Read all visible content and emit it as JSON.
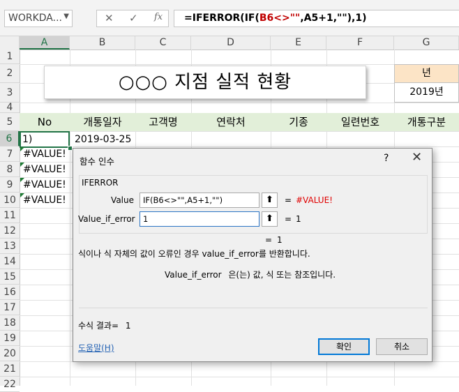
{
  "formula_bar": {
    "name_box": "WORKDA...",
    "cancel_icon": "✕",
    "enter_icon": "✓",
    "fx_icon": "fx",
    "formula_parts": [
      "=IFERROR(IF(",
      "B6<>\"\"",
      ",A5+1,\"\")",
      ",1)"
    ]
  },
  "columns": [
    "A",
    "B",
    "C",
    "D",
    "E",
    "F",
    "G"
  ],
  "rows": [
    "1",
    "2",
    "3",
    "4",
    "5",
    "6",
    "7",
    "8",
    "9",
    "10",
    "11",
    "12",
    "13",
    "14",
    "15",
    "16",
    "17",
    "18",
    "19",
    "20",
    "21",
    "22"
  ],
  "sheet": {
    "title": "○○○ 지점  실적 현황",
    "year_header": "년",
    "year_value": "2019년",
    "headers": [
      "No",
      "개통일자",
      "고객명",
      "연락처",
      "기종",
      "일련번호",
      "개통구분"
    ],
    "row6": {
      "no": "1)",
      "date": "2019-03-25"
    },
    "errors": [
      "#VALUE!",
      "#VALUE!",
      "#VALUE!",
      "#VALUE!"
    ]
  },
  "dialog": {
    "title": "함수 인수",
    "help_icon": "?",
    "close_icon": "✕",
    "function_name": "IFERROR",
    "args": [
      {
        "label": "Value",
        "value": "IF(B6<>\"\",A5+1,\"\")",
        "result": "#VALUE!"
      },
      {
        "label": "Value_if_error",
        "value": "1",
        "result": "1"
      }
    ],
    "eq": "=",
    "overall_result": "1",
    "description": "식이나 식 자체의 값이 오류인 경우 value_if_error를 반환합니다.",
    "arg_desc_name": "Value_if_error",
    "arg_desc_text": "은(는) 값, 식 또는 참조입니다.",
    "formula_result_label": "수식 결과=",
    "formula_result_value": "1",
    "help_link": "도움말(H)",
    "ok": "확인",
    "cancel": "취소"
  },
  "colors": {
    "accent": "#217346",
    "header_band": "#e2efd9",
    "year_header": "#fce4c6",
    "error": "#e00000"
  }
}
